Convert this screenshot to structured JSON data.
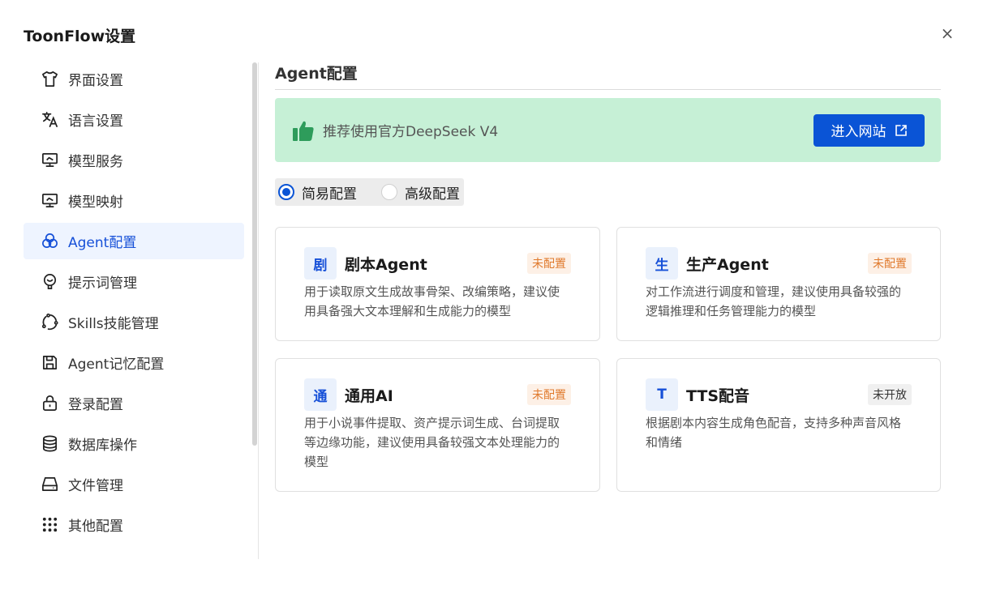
{
  "dialog": {
    "title": "ToonFlow设置",
    "close": "×"
  },
  "sidebar": {
    "items": [
      {
        "label": "界面设置",
        "icon": "shirt-icon",
        "active": false
      },
      {
        "label": "语言设置",
        "icon": "translate-icon",
        "active": false
      },
      {
        "label": "模型服务",
        "icon": "monitor-icon",
        "active": false
      },
      {
        "label": "模型映射",
        "icon": "monitor-icon",
        "active": false
      },
      {
        "label": "Agent配置",
        "icon": "circles-icon",
        "active": true
      },
      {
        "label": "提示词管理",
        "icon": "bulb-icon",
        "active": false
      },
      {
        "label": "Skills技能管理",
        "icon": "cycle-icon",
        "active": false
      },
      {
        "label": "Agent记忆配置",
        "icon": "save-icon",
        "active": false
      },
      {
        "label": "登录配置",
        "icon": "lock-icon",
        "active": false
      },
      {
        "label": "数据库操作",
        "icon": "database-icon",
        "active": false
      },
      {
        "label": "文件管理",
        "icon": "drive-icon",
        "active": false
      },
      {
        "label": "其他配置",
        "icon": "grid-dots-icon",
        "active": false
      }
    ]
  },
  "main": {
    "section_title": "Agent配置",
    "banner": {
      "text": "推荐使用官方DeepSeek V4",
      "button_label": "进入网站",
      "icon": "thumbs-up-icon",
      "color": "#c6f0d6"
    },
    "modes": [
      {
        "label": "简易配置",
        "checked": true
      },
      {
        "label": "高级配置",
        "checked": false
      }
    ],
    "cards": [
      {
        "icon_char": "剧",
        "title": "剧本Agent",
        "badge": "未配置",
        "badge_type": "warn",
        "desc": "用于读取原文生成故事骨架、改编策略，建议使用具备强大文本理解和生成能力的模型"
      },
      {
        "icon_char": "生",
        "title": "生产Agent",
        "badge": "未配置",
        "badge_type": "warn",
        "desc": "对工作流进行调度和管理，建议使用具备较强的逻辑推理和任务管理能力的模型"
      },
      {
        "icon_char": "通",
        "title": "通用AI",
        "badge": "未配置",
        "badge_type": "warn",
        "desc": "用于小说事件提取、资产提示词生成、台词提取等边缘功能，建议使用具备较强文本处理能力的模型"
      },
      {
        "icon_char": "T",
        "title": "TTS配音",
        "badge": "未开放",
        "badge_type": "gray",
        "desc": "根据剧本内容生成角色配音，支持多种声音风格和情绪"
      }
    ]
  },
  "colors": {
    "accent": "#0a54d6",
    "active_bg": "#eef4ff",
    "warn": "#e07a2d"
  }
}
